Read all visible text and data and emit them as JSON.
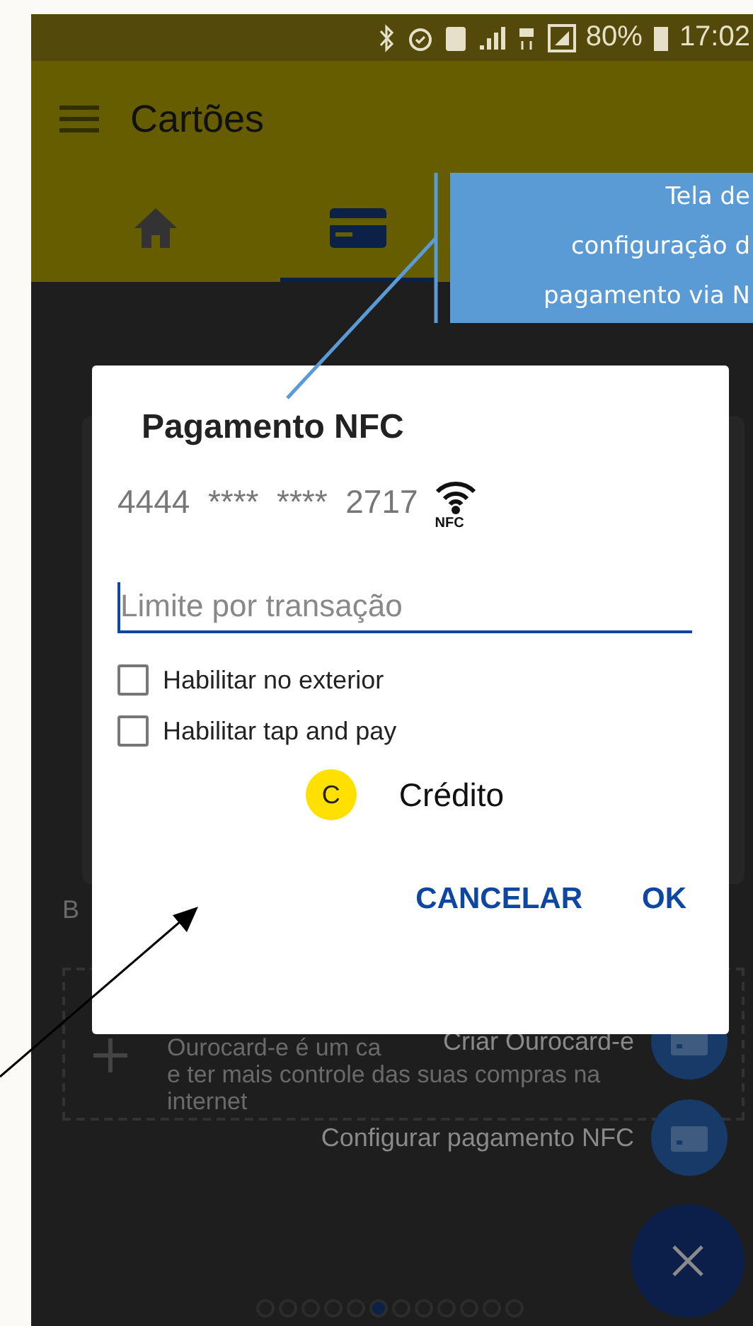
{
  "status_bar": {
    "battery": "80%",
    "time": "17:02"
  },
  "app_bar": {
    "title": "Cartões"
  },
  "tabs": [
    {
      "kind": "home",
      "selected": false
    },
    {
      "kind": "card",
      "selected": true
    }
  ],
  "background": {
    "partial_label": "B",
    "promo_lines": [
      "Ourocard-e é um ca",
      "e ter mais controle das suas compras na",
      "internet"
    ],
    "pager_dots": [
      {
        "selected": false
      },
      {
        "selected": false
      },
      {
        "selected": false
      },
      {
        "selected": false
      },
      {
        "selected": false
      },
      {
        "selected": true
      },
      {
        "selected": false
      },
      {
        "selected": false
      },
      {
        "selected": false
      },
      {
        "selected": false
      },
      {
        "selected": false
      },
      {
        "selected": false
      }
    ]
  },
  "fab_menu": {
    "actions": [
      {
        "label": "Criar Ourocard-e"
      },
      {
        "label": "Configurar pagamento NFC"
      }
    ]
  },
  "dialog": {
    "title": "Pagamento NFC",
    "card_number": "4444  ****  ****  2717",
    "nfc_label": "NFC",
    "limit_field": {
      "placeholder": "Limite por transação"
    },
    "checkboxes": [
      {
        "label": "Habilitar no exterior",
        "checked": false
      },
      {
        "label": "Habilitar tap and pay",
        "checked": false
      }
    ],
    "card_type": {
      "badge": "C",
      "label": "Crédito",
      "color": "#ffe000"
    },
    "buttons": [
      "CANCELAR",
      "OK"
    ]
  },
  "annotation": {
    "text": "Tela de\nconfiguração d\npagamento via N"
  }
}
